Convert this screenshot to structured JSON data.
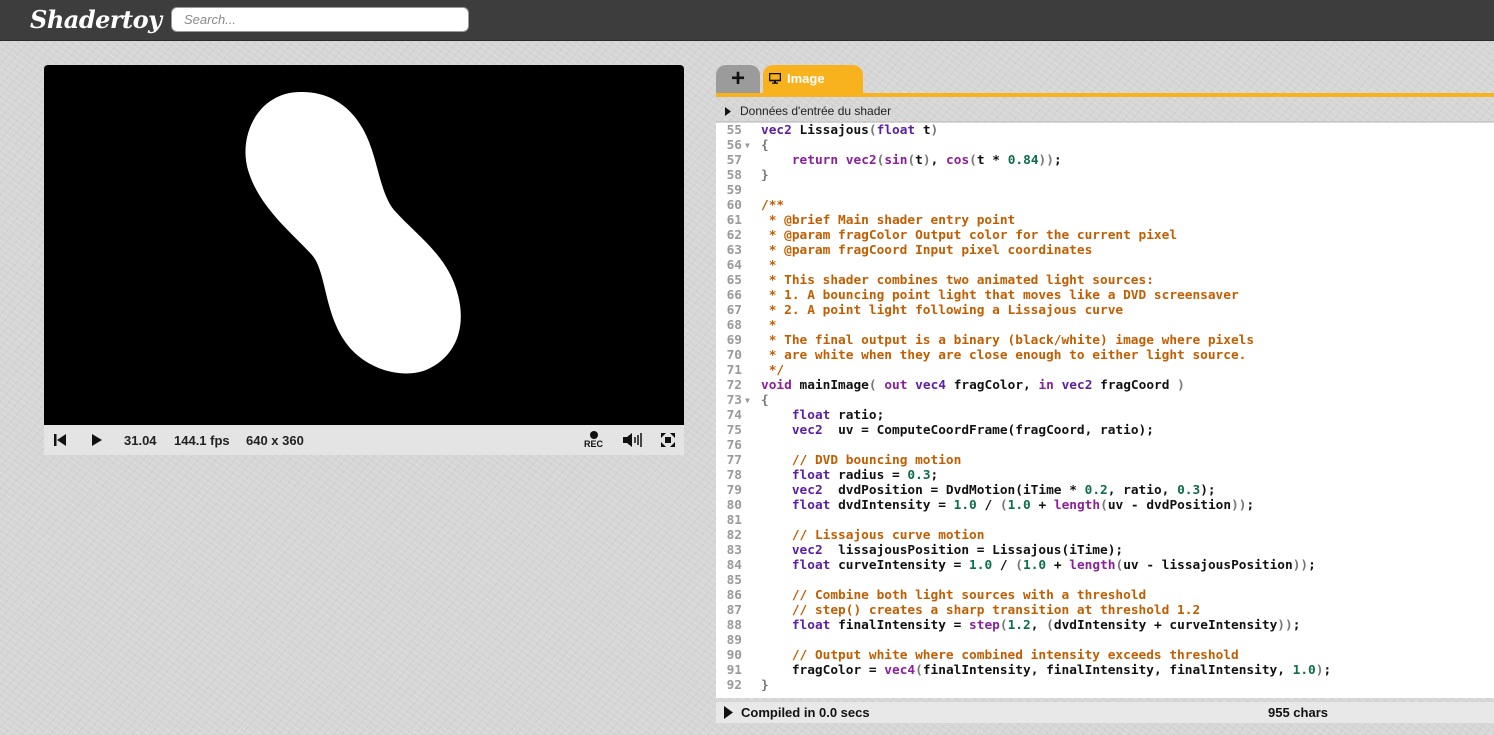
{
  "header": {
    "logo": "Shadertoy",
    "search_placeholder": "Search..."
  },
  "player": {
    "time": "31.04",
    "fps": "144.1 fps",
    "resolution": "640 x 360",
    "rec_label": "REC",
    "canvas_background": "#000000",
    "blob_color": "#ffffff"
  },
  "editor": {
    "tabs": [
      {
        "label": "+",
        "icon": "plus-icon"
      },
      {
        "label": "Image",
        "icon": "monitor-icon",
        "active": true
      }
    ],
    "accent_color": "#f7b21e",
    "inputs_label": "Données d'entrée du shader",
    "status": {
      "compiled": "Compiled in 0.0 secs",
      "chars": "955 chars"
    },
    "lines": [
      {
        "n": "55",
        "fold": false,
        "tokens": [
          [
            "type",
            "vec2"
          ],
          [
            "plain",
            " Lissajous"
          ],
          [
            "paren",
            "("
          ],
          [
            "type",
            "float"
          ],
          [
            "plain",
            " t"
          ],
          [
            "paren",
            ")"
          ]
        ]
      },
      {
        "n": "56",
        "fold": true,
        "tokens": [
          [
            "paren",
            "{"
          ]
        ]
      },
      {
        "n": "57",
        "fold": false,
        "tokens": [
          [
            "plain",
            "    "
          ],
          [
            "keyword",
            "return"
          ],
          [
            "plain",
            " "
          ],
          [
            "func",
            "vec2"
          ],
          [
            "paren",
            "("
          ],
          [
            "func",
            "sin"
          ],
          [
            "paren",
            "("
          ],
          [
            "plain",
            "t"
          ],
          [
            "paren",
            ")"
          ],
          [
            "plain",
            ", "
          ],
          [
            "func",
            "cos"
          ],
          [
            "paren",
            "("
          ],
          [
            "plain",
            "t * "
          ],
          [
            "number",
            "0.84"
          ],
          [
            "paren",
            "))"
          ],
          [
            "plain",
            ";"
          ]
        ]
      },
      {
        "n": "58",
        "fold": false,
        "tokens": [
          [
            "paren",
            "}"
          ]
        ]
      },
      {
        "n": "59",
        "fold": false,
        "tokens": []
      },
      {
        "n": "60",
        "fold": false,
        "tokens": [
          [
            "comment",
            "/**"
          ]
        ]
      },
      {
        "n": "61",
        "fold": false,
        "tokens": [
          [
            "comment",
            " * @brief Main shader entry point"
          ]
        ]
      },
      {
        "n": "62",
        "fold": false,
        "tokens": [
          [
            "comment",
            " * @param fragColor Output color for the current pixel"
          ]
        ]
      },
      {
        "n": "63",
        "fold": false,
        "tokens": [
          [
            "comment",
            " * @param fragCoord Input pixel coordinates"
          ]
        ]
      },
      {
        "n": "64",
        "fold": false,
        "tokens": [
          [
            "comment",
            " *"
          ]
        ]
      },
      {
        "n": "65",
        "fold": false,
        "tokens": [
          [
            "comment",
            " * This shader combines two animated light sources:"
          ]
        ]
      },
      {
        "n": "66",
        "fold": false,
        "tokens": [
          [
            "comment",
            " * 1. A bouncing point light that moves like a DVD screensaver"
          ]
        ]
      },
      {
        "n": "67",
        "fold": false,
        "tokens": [
          [
            "comment",
            " * 2. A point light following a Lissajous curve"
          ]
        ]
      },
      {
        "n": "68",
        "fold": false,
        "tokens": [
          [
            "comment",
            " *"
          ]
        ]
      },
      {
        "n": "69",
        "fold": false,
        "tokens": [
          [
            "comment",
            " * The final output is a binary (black/white) image where pixels"
          ]
        ]
      },
      {
        "n": "70",
        "fold": false,
        "tokens": [
          [
            "comment",
            " * are white when they are close enough to either light source."
          ]
        ]
      },
      {
        "n": "71",
        "fold": false,
        "tokens": [
          [
            "comment",
            " */"
          ]
        ]
      },
      {
        "n": "72",
        "fold": false,
        "tokens": [
          [
            "keyword",
            "void"
          ],
          [
            "plain",
            " mainImage"
          ],
          [
            "paren",
            "("
          ],
          [
            "plain",
            " "
          ],
          [
            "keyword",
            "out"
          ],
          [
            "plain",
            " "
          ],
          [
            "type",
            "vec4"
          ],
          [
            "plain",
            " fragColor, "
          ],
          [
            "keyword",
            "in"
          ],
          [
            "plain",
            " "
          ],
          [
            "type",
            "vec2"
          ],
          [
            "plain",
            " fragCoord "
          ],
          [
            "paren",
            ")"
          ]
        ]
      },
      {
        "n": "73",
        "fold": true,
        "tokens": [
          [
            "paren",
            "{"
          ]
        ]
      },
      {
        "n": "74",
        "fold": false,
        "tokens": [
          [
            "plain",
            "    "
          ],
          [
            "type",
            "float"
          ],
          [
            "plain",
            " ratio;"
          ]
        ]
      },
      {
        "n": "75",
        "fold": false,
        "tokens": [
          [
            "plain",
            "    "
          ],
          [
            "type",
            "vec2"
          ],
          [
            "plain",
            "  uv = ComputeCoordFrame(fragCoord, ratio);"
          ]
        ]
      },
      {
        "n": "76",
        "fold": false,
        "tokens": []
      },
      {
        "n": "77",
        "fold": false,
        "tokens": [
          [
            "plain",
            "    "
          ],
          [
            "comment",
            "// DVD bouncing motion"
          ]
        ]
      },
      {
        "n": "78",
        "fold": false,
        "tokens": [
          [
            "plain",
            "    "
          ],
          [
            "type",
            "float"
          ],
          [
            "plain",
            " radius = "
          ],
          [
            "number",
            "0.3"
          ],
          [
            "plain",
            ";"
          ]
        ]
      },
      {
        "n": "79",
        "fold": false,
        "tokens": [
          [
            "plain",
            "    "
          ],
          [
            "type",
            "vec2"
          ],
          [
            "plain",
            "  dvdPosition = DvdMotion(iTime * "
          ],
          [
            "number",
            "0.2"
          ],
          [
            "plain",
            ", ratio, "
          ],
          [
            "number",
            "0.3"
          ],
          [
            "plain",
            ");"
          ]
        ]
      },
      {
        "n": "80",
        "fold": false,
        "tokens": [
          [
            "plain",
            "    "
          ],
          [
            "type",
            "float"
          ],
          [
            "plain",
            " dvdIntensity = "
          ],
          [
            "number",
            "1.0"
          ],
          [
            "plain",
            " / "
          ],
          [
            "paren",
            "("
          ],
          [
            "number",
            "1.0"
          ],
          [
            "plain",
            " + "
          ],
          [
            "func",
            "length"
          ],
          [
            "paren",
            "("
          ],
          [
            "plain",
            "uv - dvdPosition"
          ],
          [
            "paren",
            "))"
          ],
          [
            "plain",
            ";"
          ]
        ]
      },
      {
        "n": "81",
        "fold": false,
        "tokens": []
      },
      {
        "n": "82",
        "fold": false,
        "tokens": [
          [
            "plain",
            "    "
          ],
          [
            "comment",
            "// Lissajous curve motion"
          ]
        ]
      },
      {
        "n": "83",
        "fold": false,
        "tokens": [
          [
            "plain",
            "    "
          ],
          [
            "type",
            "vec2"
          ],
          [
            "plain",
            "  lissajousPosition = Lissajous(iTime);"
          ]
        ]
      },
      {
        "n": "84",
        "fold": false,
        "tokens": [
          [
            "plain",
            "    "
          ],
          [
            "type",
            "float"
          ],
          [
            "plain",
            " curveIntensity = "
          ],
          [
            "number",
            "1.0"
          ],
          [
            "plain",
            " / "
          ],
          [
            "paren",
            "("
          ],
          [
            "number",
            "1.0"
          ],
          [
            "plain",
            " + "
          ],
          [
            "func",
            "length"
          ],
          [
            "paren",
            "("
          ],
          [
            "plain",
            "uv - lissajousPosition"
          ],
          [
            "paren",
            "))"
          ],
          [
            "plain",
            ";"
          ]
        ]
      },
      {
        "n": "85",
        "fold": false,
        "tokens": []
      },
      {
        "n": "86",
        "fold": false,
        "tokens": [
          [
            "plain",
            "    "
          ],
          [
            "comment",
            "// Combine both light sources with a threshold"
          ]
        ]
      },
      {
        "n": "87",
        "fold": false,
        "tokens": [
          [
            "plain",
            "    "
          ],
          [
            "comment",
            "// step() creates a sharp transition at threshold 1.2"
          ]
        ]
      },
      {
        "n": "88",
        "fold": false,
        "tokens": [
          [
            "plain",
            "    "
          ],
          [
            "type",
            "float"
          ],
          [
            "plain",
            " finalIntensity = "
          ],
          [
            "func",
            "step"
          ],
          [
            "paren",
            "("
          ],
          [
            "number",
            "1.2"
          ],
          [
            "plain",
            ", "
          ],
          [
            "paren",
            "("
          ],
          [
            "plain",
            "dvdIntensity + curveIntensity"
          ],
          [
            "paren",
            "))"
          ],
          [
            "plain",
            ";"
          ]
        ]
      },
      {
        "n": "89",
        "fold": false,
        "tokens": []
      },
      {
        "n": "90",
        "fold": false,
        "tokens": [
          [
            "plain",
            "    "
          ],
          [
            "comment",
            "// Output white where combined intensity exceeds threshold"
          ]
        ]
      },
      {
        "n": "91",
        "fold": false,
        "tokens": [
          [
            "plain",
            "    fragColor = "
          ],
          [
            "func",
            "vec4"
          ],
          [
            "paren",
            "("
          ],
          [
            "plain",
            "finalIntensity, finalIntensity, finalIntensity, "
          ],
          [
            "number",
            "1.0"
          ],
          [
            "paren",
            ")"
          ],
          [
            "plain",
            ";"
          ]
        ]
      },
      {
        "n": "92",
        "fold": false,
        "tokens": [
          [
            "paren",
            "}"
          ]
        ]
      }
    ]
  }
}
